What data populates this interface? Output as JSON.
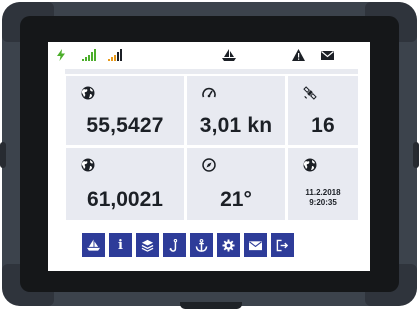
{
  "status_bar": {
    "icons": [
      "power-icon",
      "signal-strength-icon",
      "signal-strength-icon",
      "sailboat-icon",
      "warning-icon",
      "mail-icon"
    ],
    "colors": {
      "power": "#4cae2b",
      "signal_green": "#4cae2b",
      "signal_orange": "#e89a1a"
    }
  },
  "tiles": [
    {
      "icon": "globe-icon",
      "value": "55,5427"
    },
    {
      "icon": "speedometer-icon",
      "value": "3,01 kn"
    },
    {
      "icon": "satellite-icon",
      "value": "16"
    },
    {
      "icon": "globe-icon",
      "value": "61,0021"
    },
    {
      "icon": "compass-icon",
      "value": "21°"
    },
    {
      "icon": "globe-icon",
      "date": "11.2.2018",
      "time": "9:20:35"
    }
  ],
  "nav": {
    "info_label": "i",
    "icons": [
      "sailboat-icon",
      "info-icon",
      "layers-icon",
      "hook-icon",
      "anchor-icon",
      "settings-icon",
      "mail-icon",
      "logout-icon"
    ],
    "button_color": "#2e3c99"
  }
}
